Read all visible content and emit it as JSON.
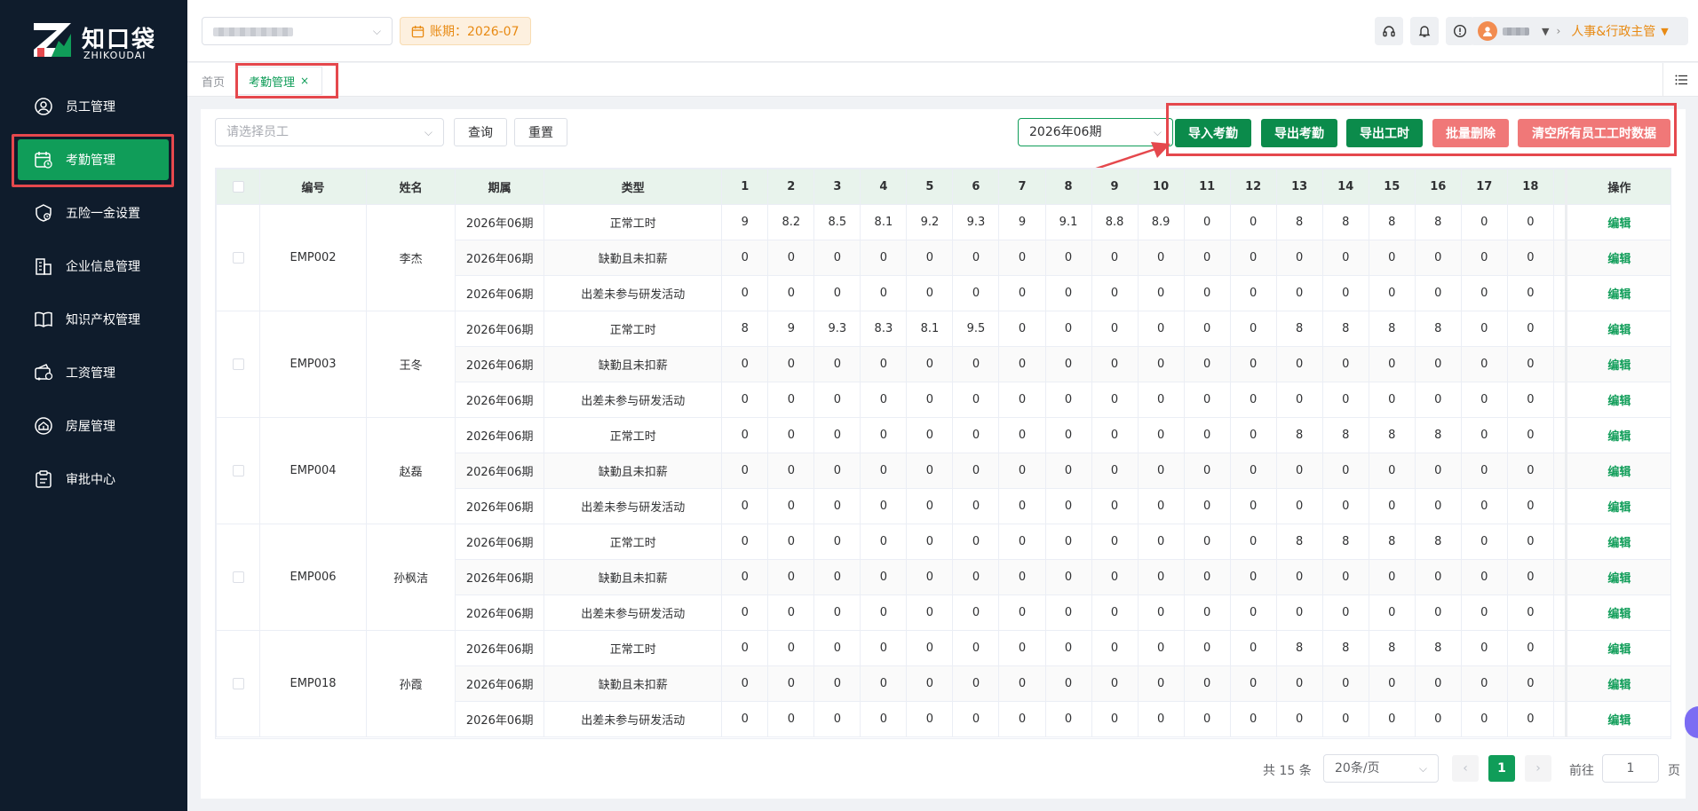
{
  "brand": {
    "name": "知口袋",
    "sub": "ZHIKOUDAI"
  },
  "sidebar": {
    "items": [
      {
        "label": "员工管理",
        "icon": "user-circle-icon"
      },
      {
        "label": "考勤管理",
        "icon": "calendar-clock-icon",
        "active": true
      },
      {
        "label": "五险一金设置",
        "icon": "shield-house-icon"
      },
      {
        "label": "企业信息管理",
        "icon": "building-icon"
      },
      {
        "label": "知识产权管理",
        "icon": "book-icon"
      },
      {
        "label": "工资管理",
        "icon": "wallet-icon"
      },
      {
        "label": "房屋管理",
        "icon": "house-icon"
      },
      {
        "label": "审批中心",
        "icon": "clipboard-icon"
      }
    ]
  },
  "header": {
    "period_label": "账期：2026-07",
    "role": "人事&行政主管"
  },
  "tabs": {
    "home": "首页",
    "active": "考勤管理",
    "close": "×"
  },
  "toolbar": {
    "employee_placeholder": "请选择员工",
    "query": "查询",
    "reset": "重置",
    "period_value": "2026年06期",
    "import": "导入考勤",
    "export": "导出考勤",
    "export_hours": "导出工时",
    "batch_delete": "批量删除",
    "clear_all": "清空所有员工工时数据"
  },
  "table": {
    "headers": [
      "编号",
      "姓名",
      "期属",
      "类型"
    ],
    "day_headers": [
      "1",
      "2",
      "3",
      "4",
      "5",
      "6",
      "7",
      "8",
      "9",
      "10",
      "11",
      "12",
      "13",
      "14",
      "15",
      "16",
      "17",
      "18"
    ],
    "op_header": "操作",
    "edit_label": "编辑",
    "groups": [
      {
        "id": "EMP002",
        "name": "李杰",
        "rows": [
          {
            "period": "2026年06期",
            "type": "正常工时",
            "days": [
              "9",
              "8.2",
              "8.5",
              "8.1",
              "9.2",
              "9.3",
              "9",
              "9.1",
              "8.8",
              "8.9",
              "0",
              "0",
              "8",
              "8",
              "8",
              "8",
              "0",
              "0"
            ]
          },
          {
            "period": "2026年06期",
            "type": "缺勤且未扣薪",
            "days": [
              "0",
              "0",
              "0",
              "0",
              "0",
              "0",
              "0",
              "0",
              "0",
              "0",
              "0",
              "0",
              "0",
              "0",
              "0",
              "0",
              "0",
              "0"
            ]
          },
          {
            "period": "2026年06期",
            "type": "出差未参与研发活动",
            "days": [
              "0",
              "0",
              "0",
              "0",
              "0",
              "0",
              "0",
              "0",
              "0",
              "0",
              "0",
              "0",
              "0",
              "0",
              "0",
              "0",
              "0",
              "0"
            ]
          }
        ]
      },
      {
        "id": "EMP003",
        "name": "王冬",
        "rows": [
          {
            "period": "2026年06期",
            "type": "正常工时",
            "days": [
              "8",
              "9",
              "9.3",
              "8.3",
              "8.1",
              "9.5",
              "0",
              "0",
              "0",
              "0",
              "0",
              "0",
              "8",
              "8",
              "8",
              "8",
              "0",
              "0"
            ]
          },
          {
            "period": "2026年06期",
            "type": "缺勤且未扣薪",
            "days": [
              "0",
              "0",
              "0",
              "0",
              "0",
              "0",
              "0",
              "0",
              "0",
              "0",
              "0",
              "0",
              "0",
              "0",
              "0",
              "0",
              "0",
              "0"
            ]
          },
          {
            "period": "2026年06期",
            "type": "出差未参与研发活动",
            "days": [
              "0",
              "0",
              "0",
              "0",
              "0",
              "0",
              "0",
              "0",
              "0",
              "0",
              "0",
              "0",
              "0",
              "0",
              "0",
              "0",
              "0",
              "0"
            ]
          }
        ]
      },
      {
        "id": "EMP004",
        "name": "赵磊",
        "rows": [
          {
            "period": "2026年06期",
            "type": "正常工时",
            "days": [
              "0",
              "0",
              "0",
              "0",
              "0",
              "0",
              "0",
              "0",
              "0",
              "0",
              "0",
              "0",
              "8",
              "8",
              "8",
              "8",
              "0",
              "0"
            ]
          },
          {
            "period": "2026年06期",
            "type": "缺勤且未扣薪",
            "days": [
              "0",
              "0",
              "0",
              "0",
              "0",
              "0",
              "0",
              "0",
              "0",
              "0",
              "0",
              "0",
              "0",
              "0",
              "0",
              "0",
              "0",
              "0"
            ]
          },
          {
            "period": "2026年06期",
            "type": "出差未参与研发活动",
            "days": [
              "0",
              "0",
              "0",
              "0",
              "0",
              "0",
              "0",
              "0",
              "0",
              "0",
              "0",
              "0",
              "0",
              "0",
              "0",
              "0",
              "0",
              "0"
            ]
          }
        ]
      },
      {
        "id": "EMP006",
        "name": "孙枫洁",
        "rows": [
          {
            "period": "2026年06期",
            "type": "正常工时",
            "days": [
              "0",
              "0",
              "0",
              "0",
              "0",
              "0",
              "0",
              "0",
              "0",
              "0",
              "0",
              "0",
              "8",
              "8",
              "8",
              "8",
              "0",
              "0"
            ]
          },
          {
            "period": "2026年06期",
            "type": "缺勤且未扣薪",
            "days": [
              "0",
              "0",
              "0",
              "0",
              "0",
              "0",
              "0",
              "0",
              "0",
              "0",
              "0",
              "0",
              "0",
              "0",
              "0",
              "0",
              "0",
              "0"
            ]
          },
          {
            "period": "2026年06期",
            "type": "出差未参与研发活动",
            "days": [
              "0",
              "0",
              "0",
              "0",
              "0",
              "0",
              "0",
              "0",
              "0",
              "0",
              "0",
              "0",
              "0",
              "0",
              "0",
              "0",
              "0",
              "0"
            ]
          }
        ]
      },
      {
        "id": "EMP018",
        "name": "孙霞",
        "rows": [
          {
            "period": "2026年06期",
            "type": "正常工时",
            "days": [
              "0",
              "0",
              "0",
              "0",
              "0",
              "0",
              "0",
              "0",
              "0",
              "0",
              "0",
              "0",
              "8",
              "8",
              "8",
              "8",
              "0",
              "0"
            ]
          },
          {
            "period": "2026年06期",
            "type": "缺勤且未扣薪",
            "days": [
              "0",
              "0",
              "0",
              "0",
              "0",
              "0",
              "0",
              "0",
              "0",
              "0",
              "0",
              "0",
              "0",
              "0",
              "0",
              "0",
              "0",
              "0"
            ]
          },
          {
            "period": "2026年06期",
            "type": "出差未参与研发活动",
            "days": [
              "0",
              "0",
              "0",
              "0",
              "0",
              "0",
              "0",
              "0",
              "0",
              "0",
              "0",
              "0",
              "0",
              "0",
              "0",
              "0",
              "0",
              "0"
            ]
          }
        ]
      }
    ]
  },
  "pagination": {
    "total": "共 15 条",
    "page_size": "20条/页",
    "prev": "‹",
    "current": "1",
    "next": "›",
    "goto": "前往",
    "goto_value": "1",
    "unit": "页"
  },
  "colors": {
    "primary": "#109d59",
    "danger": "#f07878",
    "sidebar": "#0f1c2c",
    "warn": "#e88a13"
  }
}
